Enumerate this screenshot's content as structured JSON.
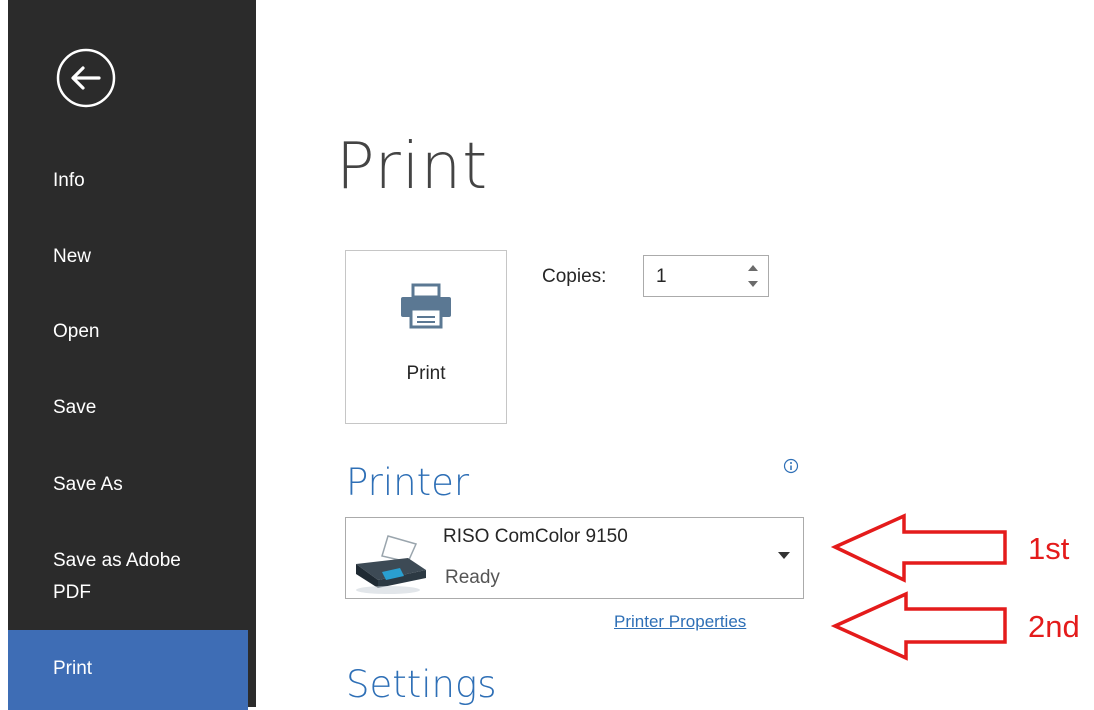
{
  "sidebar": {
    "items": [
      {
        "label": "Info"
      },
      {
        "label": "New"
      },
      {
        "label": "Open"
      },
      {
        "label": "Save"
      },
      {
        "label": "Save As"
      },
      {
        "label": "Save as Adobe PDF"
      },
      {
        "label": "Print",
        "active": true
      }
    ]
  },
  "main": {
    "title": "Print",
    "print_button_label": "Print",
    "copies_label": "Copies:",
    "copies_value": "1",
    "printer_heading": "Printer",
    "printer": {
      "name": "RISO ComColor 9150",
      "status": "Ready"
    },
    "printer_properties_link": "Printer Properties",
    "settings_heading": "Settings"
  },
  "annotations": {
    "first_label": "1st",
    "second_label": "2nd"
  },
  "colors": {
    "sidebar_bg": "#2b2b2b",
    "sidebar_active": "#3e6db5",
    "accent": "#2e6fb6",
    "annotation": "#e41b1b"
  },
  "icons": [
    "back-arrow-icon",
    "printer-icon",
    "spin-up-icon",
    "spin-down-icon",
    "info-icon",
    "printer-device-icon",
    "dropdown-caret-icon"
  ]
}
